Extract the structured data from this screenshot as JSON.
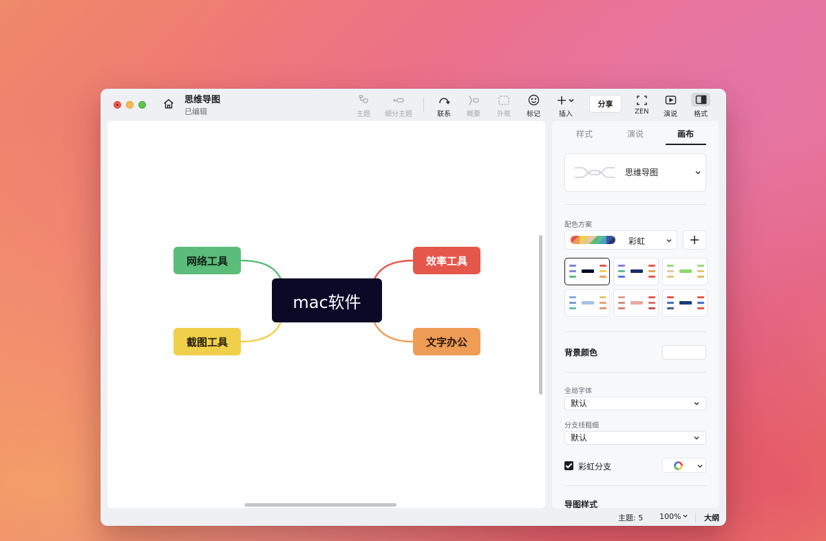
{
  "window": {
    "title": "思维导图",
    "status": "已编辑"
  },
  "toolbar": {
    "topic": "主题",
    "subtopic": "细分主题",
    "relationship": "联系",
    "summary": "概要",
    "boundary": "外框",
    "marker": "标记",
    "insert": "插入",
    "share": "分享",
    "zen": "ZEN",
    "presentation": "演说",
    "format": "格式"
  },
  "mindmap": {
    "root": "mac软件",
    "branches": [
      {
        "label": "网络工具",
        "color": "#5cbc7a"
      },
      {
        "label": "效率工具",
        "color": "#e5574a"
      },
      {
        "label": "截图工具",
        "color": "#f0d04a"
      },
      {
        "label": "文字办公",
        "color": "#ee9c56"
      }
    ],
    "root_color": "#0a0a28"
  },
  "panel": {
    "tabs": [
      "样式",
      "演说",
      "画布"
    ],
    "active_tab": "画布",
    "structure": "思维导图",
    "color_scheme_label": "配色方案",
    "color_scheme_value": "彩虹",
    "background_label": "背景颜色",
    "font_label": "全局字体",
    "font_value": "默认",
    "branch_width_label": "分支线粗细",
    "branch_width_value": "默认",
    "rainbow_branch_label": "彩虹分支",
    "rainbow_branch_checked": true,
    "map_style_label": "导图样式"
  },
  "statusbar": {
    "topics": "主题: 5",
    "zoom": "100%",
    "outline": "大纲"
  }
}
